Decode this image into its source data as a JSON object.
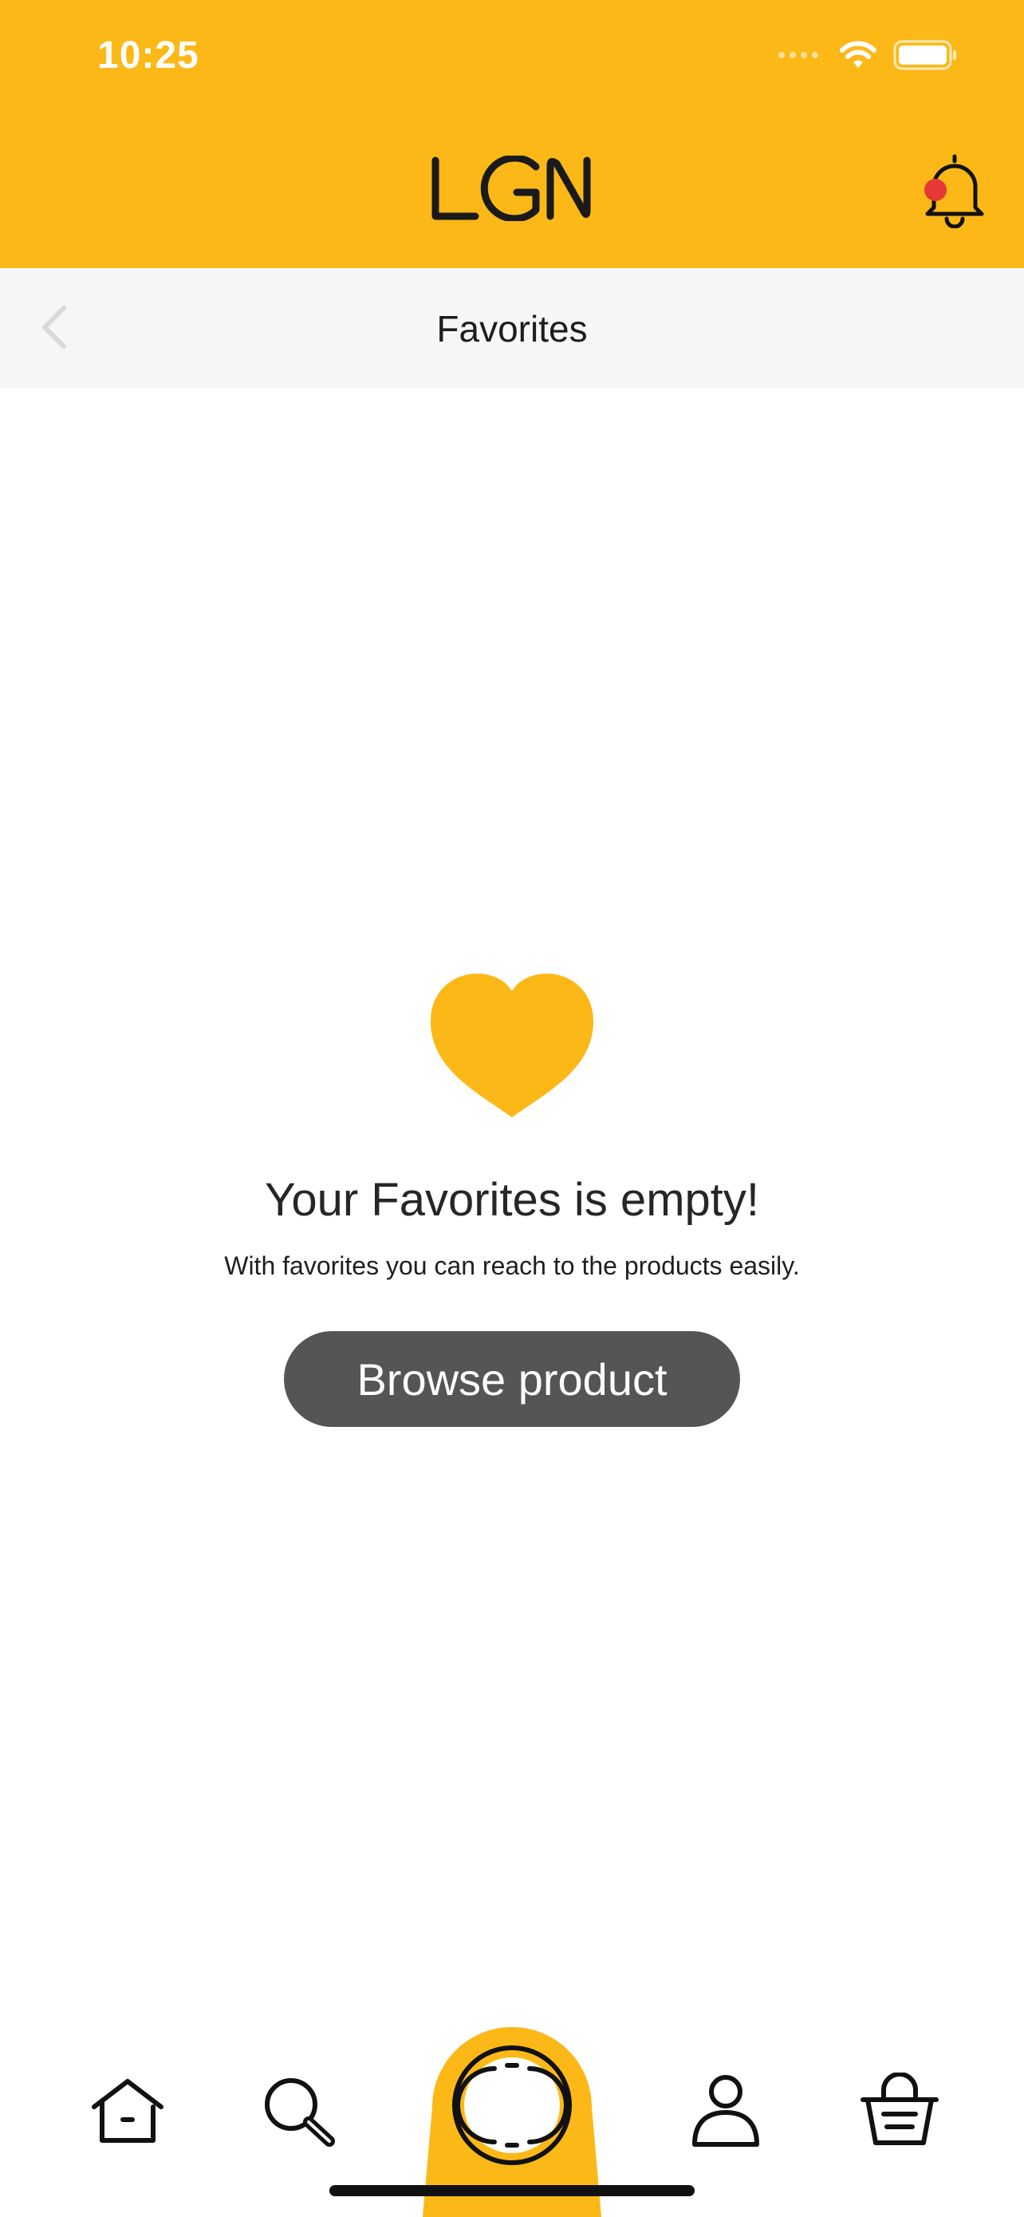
{
  "status_bar": {
    "time": "10:25",
    "icons": [
      "signal-dots-icon",
      "wifi-icon",
      "battery-icon"
    ]
  },
  "header": {
    "logo_text": "LGN",
    "notification_badge_color": "#E53935",
    "background_color": "#FBB817"
  },
  "nav": {
    "title": "Favorites",
    "back_icon": "chevron-left-icon"
  },
  "empty_state": {
    "icon": "heart-icon",
    "icon_color": "#FBB817",
    "title": "Your Favorites is empty!",
    "subtitle": "With favorites you can reach to the products easily.",
    "button_label": "Browse product",
    "button_color": "#555555"
  },
  "tab_bar": {
    "items": [
      {
        "name": "home",
        "icon": "home-icon"
      },
      {
        "name": "search",
        "icon": "search-icon"
      },
      {
        "name": "center",
        "icon": "scan-circle-icon"
      },
      {
        "name": "profile",
        "icon": "person-icon"
      },
      {
        "name": "cart",
        "icon": "basket-icon"
      }
    ]
  }
}
